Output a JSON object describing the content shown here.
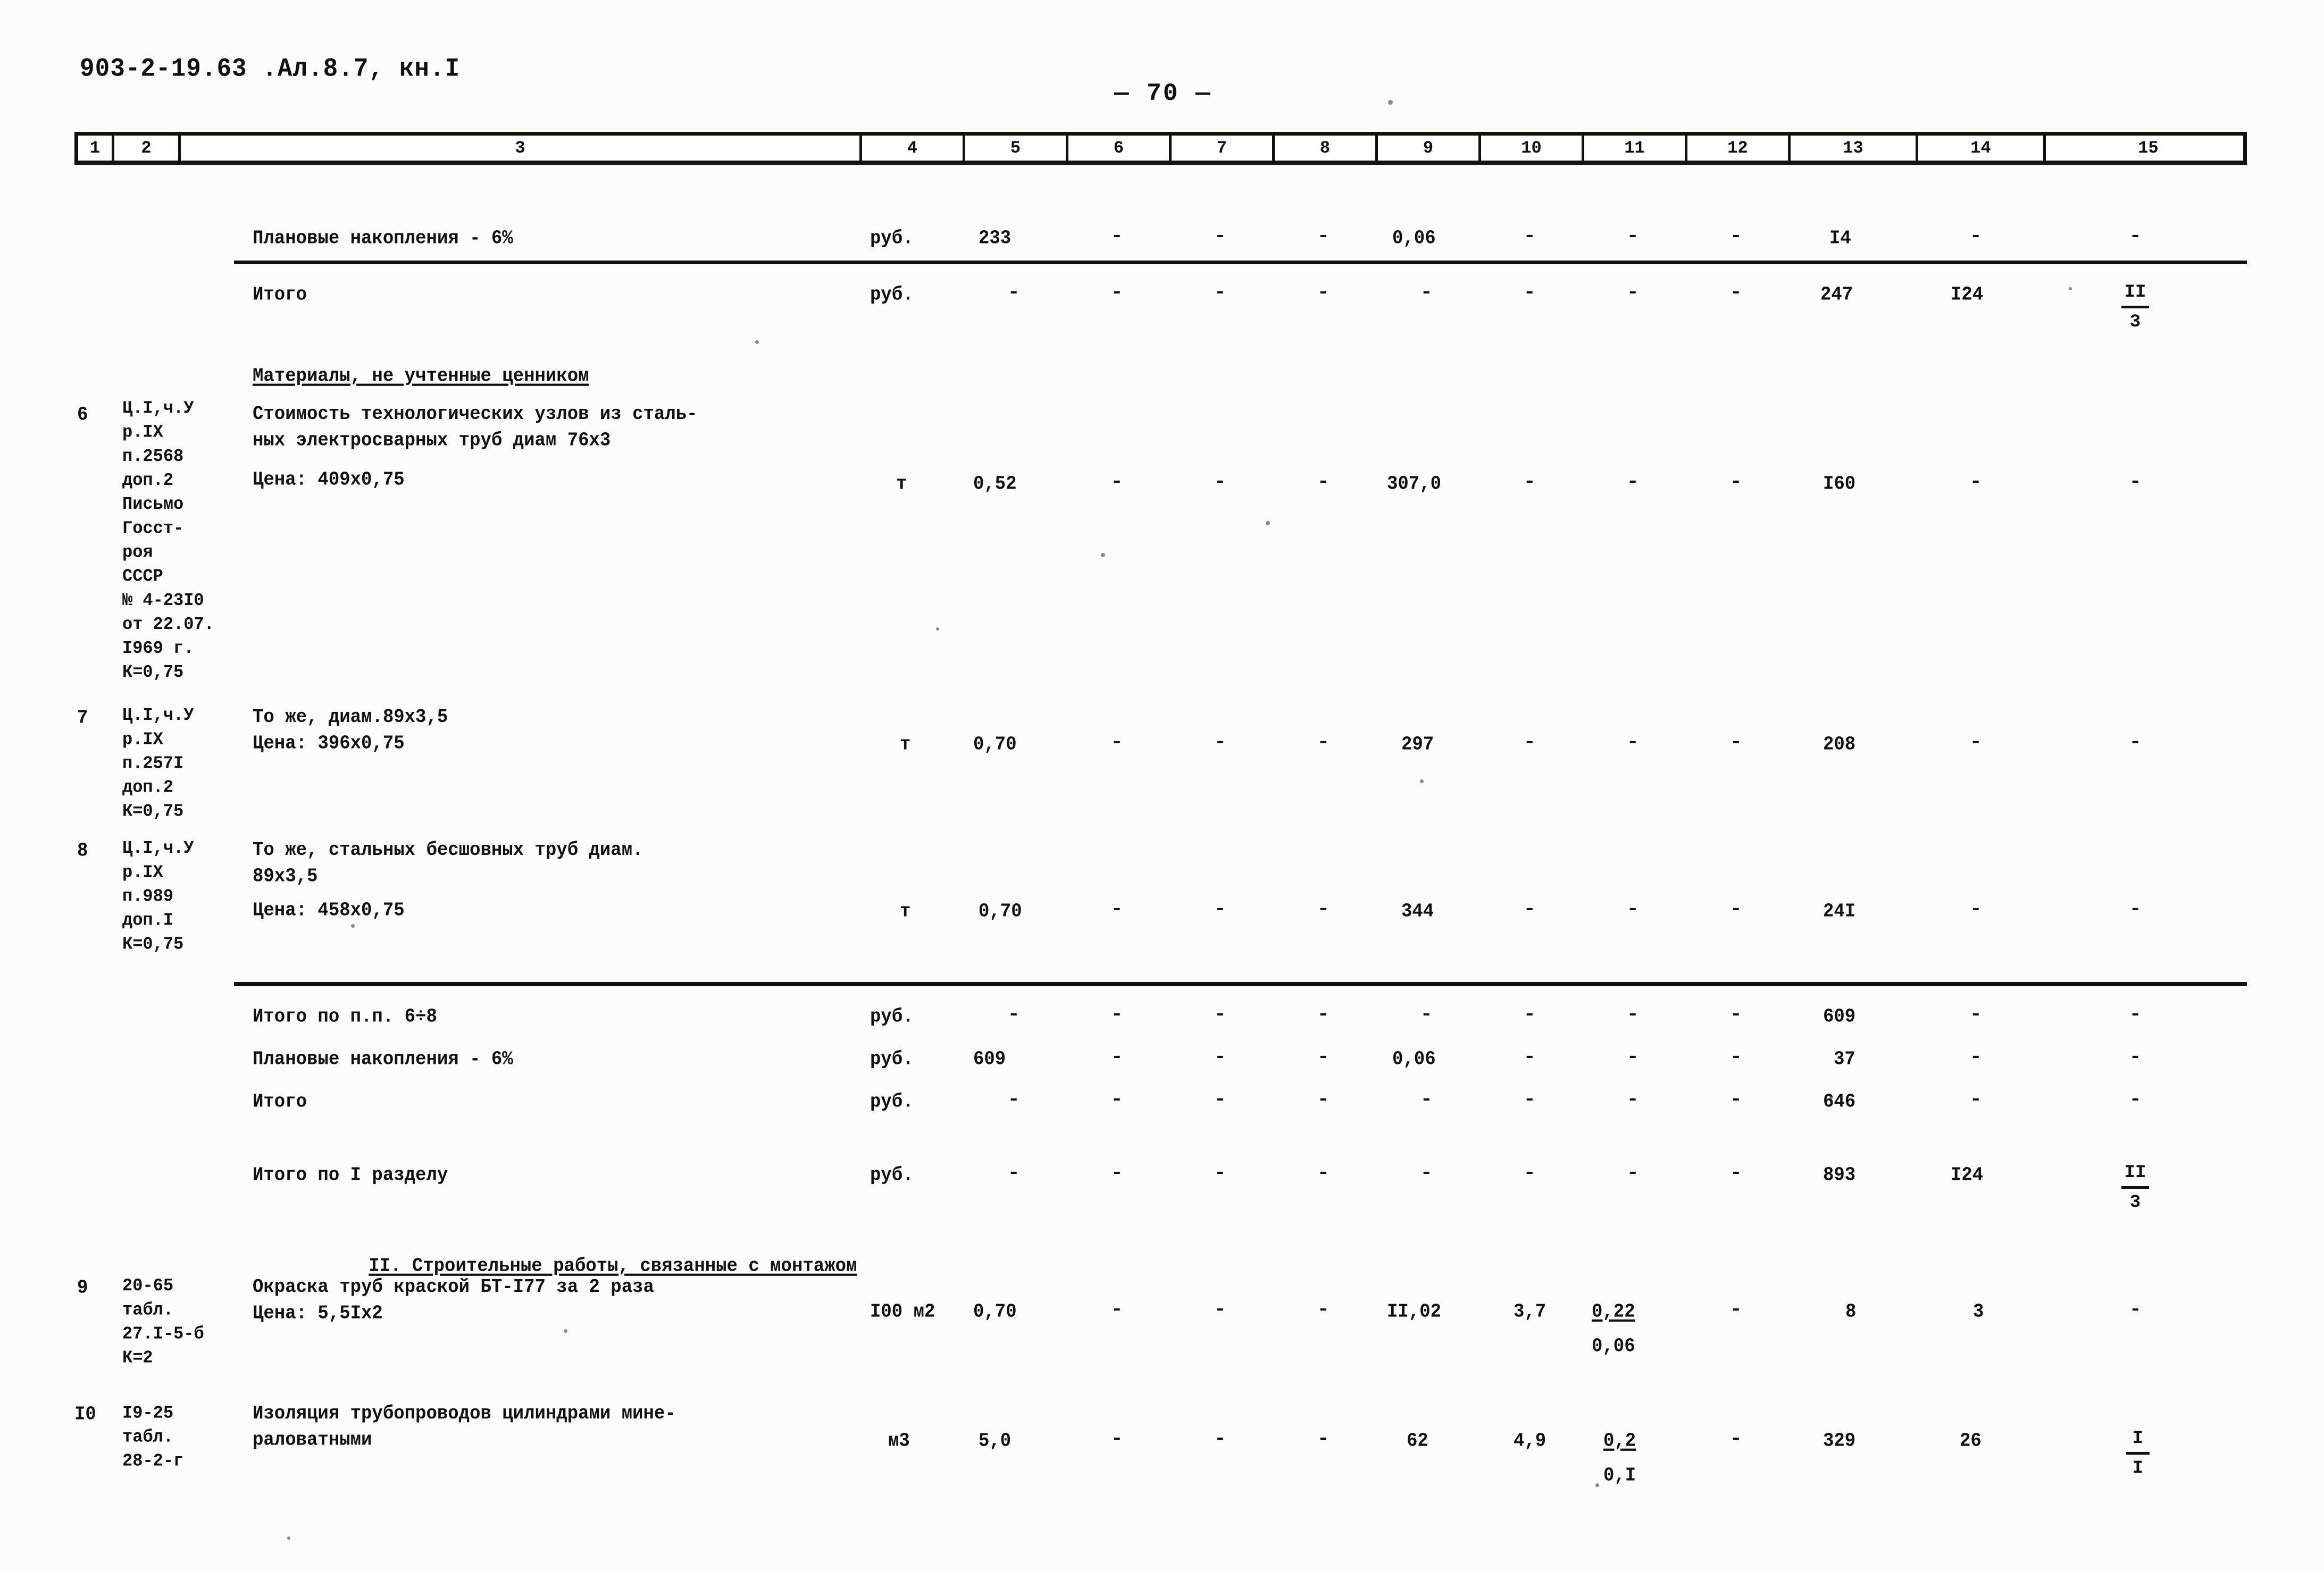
{
  "header": {
    "doc_code": "903-2-19.63 .Ал.8.7, кн.I",
    "page_label": "— 70 —"
  },
  "table": {
    "column_headers": [
      "1",
      "2",
      "3",
      "4",
      "5",
      "6",
      "7",
      "8",
      "9",
      "10",
      "11",
      "12",
      "13",
      "14",
      "15"
    ],
    "rows": [
      {
        "id": "row-planovye-6",
        "num": "",
        "ref": "",
        "desc": "Плановые накопления - 6%",
        "unit": "руб.",
        "c5": "233",
        "c6": "-",
        "c7": "-",
        "c8": "-",
        "c9": "0,06",
        "c10": "-",
        "c11": "-",
        "c12": "-",
        "c13": "I4",
        "c14": "-",
        "c15": "-"
      },
      {
        "id": "row-itogo-1",
        "num": "",
        "ref": "",
        "desc": "Итого",
        "unit": "руб.",
        "c5": "-",
        "c6": "-",
        "c7": "-",
        "c8": "-",
        "c9": "-",
        "c10": "-",
        "c11": "-",
        "c12": "-",
        "c13": "247",
        "c14": "I24",
        "c15_frac_top": "II",
        "c15_frac_bottom": "3"
      },
      {
        "id": "row-section-materials",
        "desc": "Материалы, не учтенные ценником"
      },
      {
        "id": "row-6",
        "num": "6",
        "ref": "Ц.I,ч.У\nр.IX\nп.2568\nдоп.2\nПисьмо\nГосст-\nроя\nСССР\n№ 4-23I0\nот 22.07.\nI969 г.\nК=0,75",
        "desc": "Стоимость технологических узлов из сталь-\nных электросварных труб диам 76х3",
        "desc2": "Цена: 409х0,75",
        "unit": "т",
        "c5": "0,52",
        "c6": "-",
        "c7": "-",
        "c8": "-",
        "c9": "307,0",
        "c10": "-",
        "c11": "-",
        "c12": "-",
        "c13": "I60",
        "c14": "-",
        "c15": "-"
      },
      {
        "id": "row-7",
        "num": "7",
        "ref": "Ц.I,ч.У\nр.IX\nп.257I\nдоп.2\nК=0,75",
        "desc": "То же, диам.89х3,5\nЦена: 396х0,75",
        "unit": "т",
        "c5": "0,70",
        "c6": "-",
        "c7": "-",
        "c8": "-",
        "c9": "297",
        "c10": "-",
        "c11": "-",
        "c12": "-",
        "c13": "208",
        "c14": "-",
        "c15": "-"
      },
      {
        "id": "row-8",
        "num": "8",
        "ref": "Ц.I,ч.У\nр.IX\nп.989\nдоп.I\nК=0,75",
        "desc": "То же, стальных бесшовных труб диам.\n89х3,5",
        "desc2": "Цена: 458х0,75",
        "unit": "т",
        "c5": "0,70",
        "c6": "-",
        "c7": "-",
        "c8": "-",
        "c9": "344",
        "c10": "-",
        "c11": "-",
        "c12": "-",
        "c13": "24I",
        "c14": "-",
        "c15": "-"
      },
      {
        "id": "row-itogo-6-8",
        "desc": "Итого по п.п. 6÷8",
        "unit": "руб.",
        "c5": "-",
        "c6": "-",
        "c7": "-",
        "c8": "-",
        "c9": "-",
        "c10": "-",
        "c11": "-",
        "c12": "-",
        "c13": "609",
        "c14": "-",
        "c15": "-"
      },
      {
        "id": "row-planovye-6-b",
        "desc": "Плановые накопления - 6%",
        "unit": "руб.",
        "c5": "609",
        "c6": "-",
        "c7": "-",
        "c8": "-",
        "c9": "0,06",
        "c10": "-",
        "c11": "-",
        "c12": "-",
        "c13": "37",
        "c14": "-",
        "c15": "-"
      },
      {
        "id": "row-itogo-2",
        "desc": "Итого",
        "unit": "руб.",
        "c5": "-",
        "c6": "-",
        "c7": "-",
        "c8": "-",
        "c9": "-",
        "c10": "-",
        "c11": "-",
        "c12": "-",
        "c13": "646",
        "c14": "-",
        "c15": "-"
      },
      {
        "id": "row-itogo-razdel-1",
        "desc": "Итого по I разделу",
        "unit": "руб.",
        "c5": "-",
        "c6": "-",
        "c7": "-",
        "c8": "-",
        "c9": "-",
        "c10": "-",
        "c11": "-",
        "c12": "-",
        "c13": "893",
        "c14": "I24",
        "c15_frac_top": "II",
        "c15_frac_bottom": "3"
      },
      {
        "id": "row-section-2",
        "desc": "II. Строительные работы, связанные с монтажом"
      },
      {
        "id": "row-9",
        "num": "9",
        "ref": "20-65\nтабл.\n27.I-5-б\nК=2",
        "desc": "Окраска труб краской БТ-I77 за 2 раза\nЦена: 5,5Iх2",
        "unit": "I00 м2",
        "c5": "0,70",
        "c6": "-",
        "c7": "-",
        "c8": "-",
        "c9": "II,02",
        "c10": "3,7",
        "c11_top": "0,22",
        "c11_bottom": "0,06",
        "c12": "-",
        "c13": "8",
        "c14": "3",
        "c15": "-"
      },
      {
        "id": "row-10",
        "num": "I0",
        "ref": "I9-25\nтабл.\n28-2-г",
        "desc": "Изоляция трубопроводов цилиндрами мине-\nраловатными",
        "unit": "м3",
        "c5": "5,0",
        "c6": "-",
        "c7": "-",
        "c8": "-",
        "c9": "62",
        "c10": "4,9",
        "c11_top": "0,2",
        "c11_bottom": "0,I",
        "c12": "-",
        "c13": "329",
        "c14": "26",
        "c15_frac_top": "I",
        "c15_frac_bottom": "I"
      }
    ]
  }
}
